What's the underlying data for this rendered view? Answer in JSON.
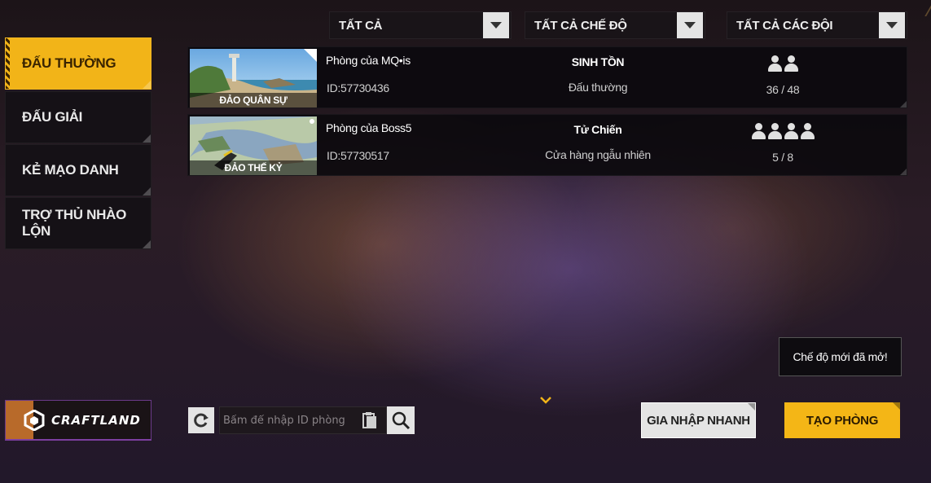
{
  "filters": {
    "all": "TẤT CẢ",
    "all_modes": "TẤT CẢ CHẾ ĐỘ",
    "all_teams": "TẤT CẢ CÁC ĐỘI"
  },
  "sidebar": {
    "items": [
      {
        "label": "ĐẤU THƯỜNG",
        "active": true
      },
      {
        "label": "ĐẤU GIẢI",
        "active": false
      },
      {
        "label": "KẺ MẠO DANH",
        "active": false
      },
      {
        "label": "TRỢ THỦ NHÀO LỘN",
        "active": false
      }
    ]
  },
  "rooms": [
    {
      "map": "ĐẢO QUÂN SỰ",
      "name": "Phòng của MQ•is",
      "id": "ID:57730436",
      "mode": "SINH TỒN",
      "submode": "Đấu thường",
      "team_icon": "duo-person-icon",
      "players": "36 / 48"
    },
    {
      "map": "ĐẢO THẾ KỶ",
      "name": "Phòng của Boss5",
      "id": "ID:57730517",
      "mode": "Tử Chiến",
      "submode": "Cửa hàng ngẫu nhiên",
      "team_icon": "squad-person-icon",
      "players": "5 / 8"
    }
  ],
  "toast": "Chế độ mới đã mở!",
  "craftland": "CRAFTLAND",
  "search": {
    "placeholder": "Bấm để nhập ID phòng"
  },
  "buttons": {
    "quick_join": "GIA NHẬP NHANH",
    "create_room": "TẠO PHÒNG"
  },
  "colors": {
    "accent": "#f2b418",
    "panel": "#151116",
    "light_button": "#e4e4e4"
  }
}
